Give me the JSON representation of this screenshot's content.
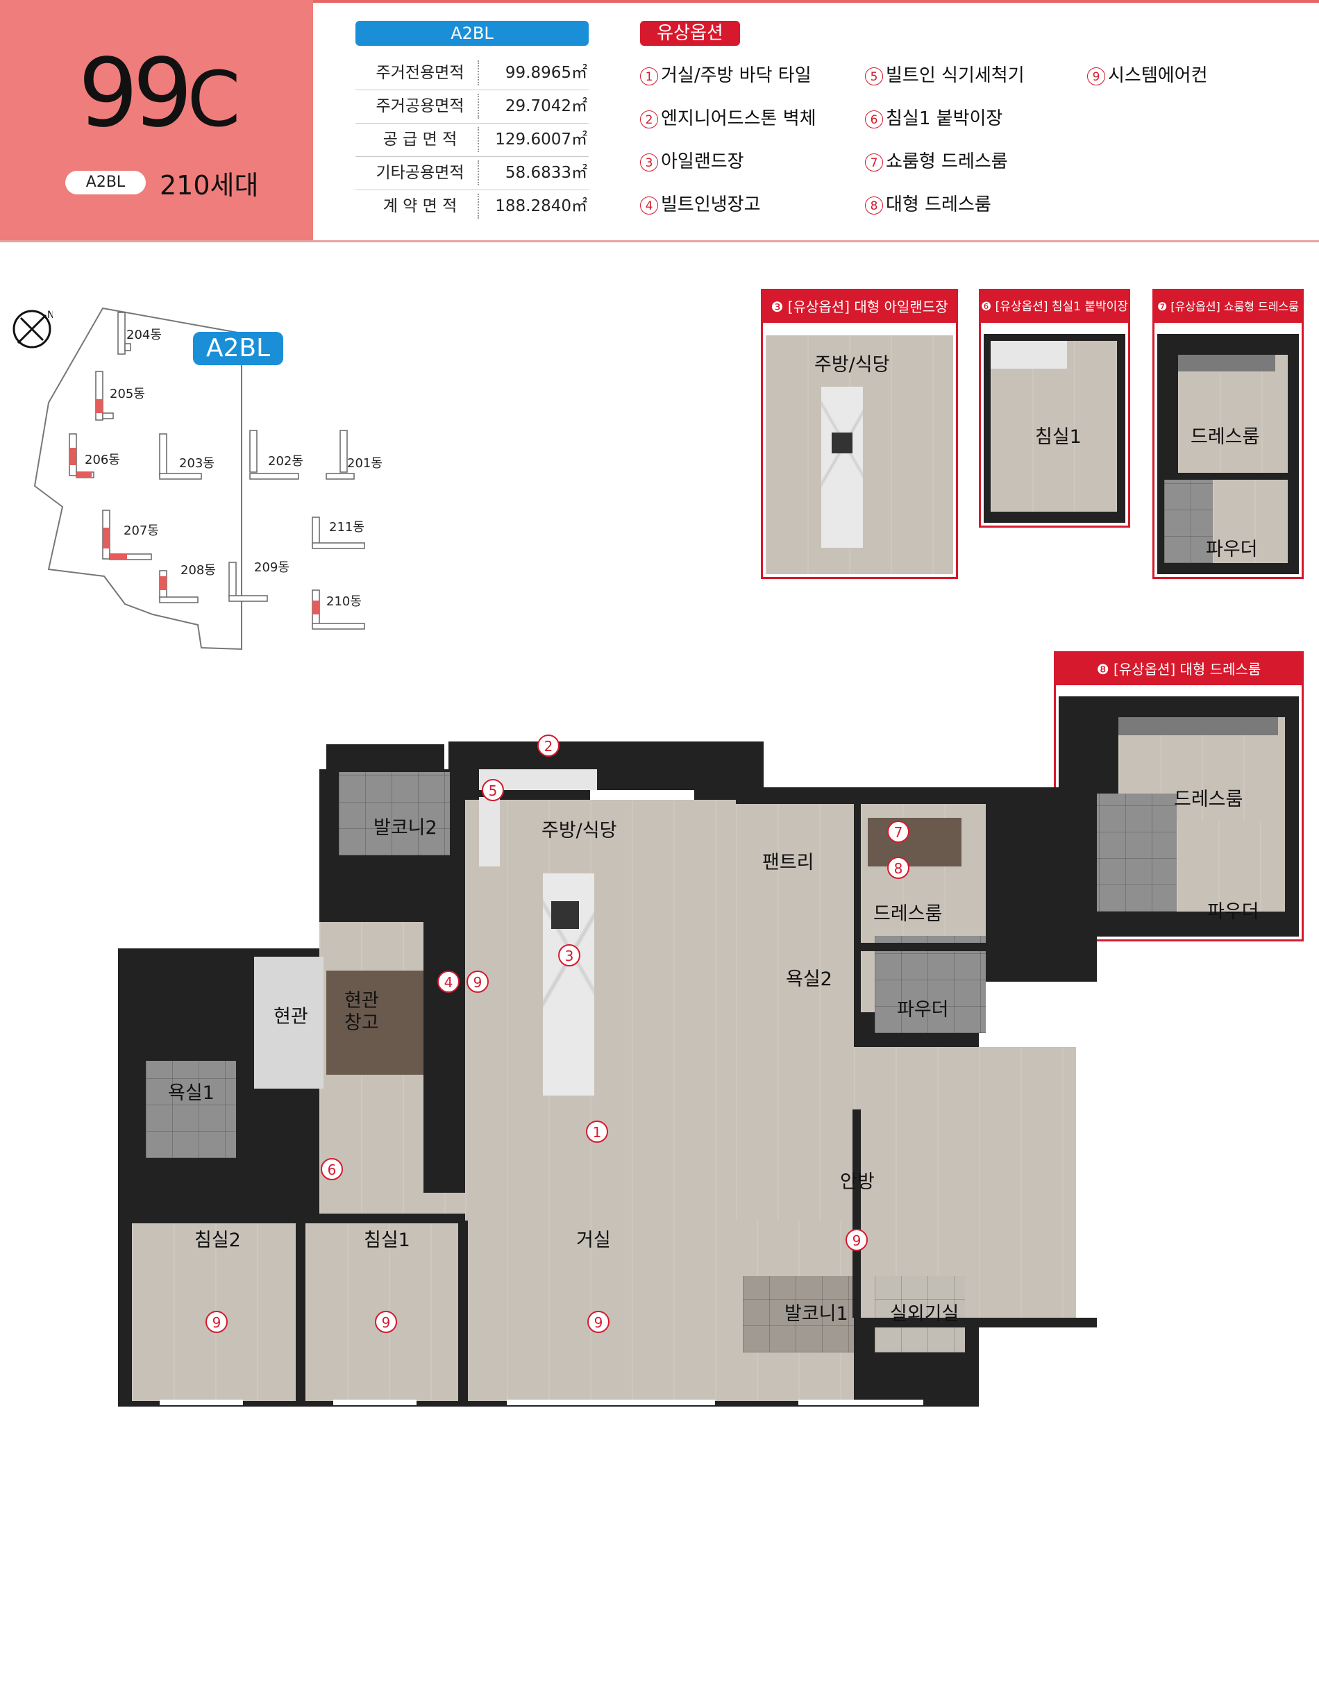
{
  "unit": {
    "type_number": "99",
    "type_suffix": "C",
    "block_tag": "A2BL",
    "households": "210세대"
  },
  "area_table": {
    "header": "A2BL",
    "rows": [
      {
        "label": "주거전용면적",
        "value": "99.8965㎡"
      },
      {
        "label": "주거공용면적",
        "value": "29.7042㎡"
      },
      {
        "label": "공 급 면 적",
        "value": "129.6007㎡"
      },
      {
        "label": "기타공용면적",
        "value": "58.6833㎡"
      },
      {
        "label": "계 약 면 적",
        "value": "188.2840㎡"
      }
    ]
  },
  "paid_options": {
    "header": "유상옵션",
    "items": [
      {
        "num": "1",
        "label": "거실/주방 바닥 타일"
      },
      {
        "num": "2",
        "label": "엔지니어드스톤 벽체"
      },
      {
        "num": "3",
        "label": "아일랜드장"
      },
      {
        "num": "4",
        "label": "빌트인냉장고"
      },
      {
        "num": "5",
        "label": "빌트인 식기세척기"
      },
      {
        "num": "6",
        "label": "침실1 붙박이장"
      },
      {
        "num": "7",
        "label": "쇼룸형 드레스룸"
      },
      {
        "num": "8",
        "label": "대형 드레스룸"
      },
      {
        "num": "9",
        "label": "시스템에어컨"
      }
    ]
  },
  "site_map": {
    "badge": "A2BL",
    "compass_letter": "N",
    "buildings": [
      "204동",
      "205동",
      "206동",
      "203동",
      "202동",
      "201동",
      "207동",
      "211동",
      "208동",
      "209동",
      "210동"
    ]
  },
  "option_panels": [
    {
      "title": "❸ [유상옵션] 대형 아일랜드장",
      "labels": [
        "주방/식당"
      ]
    },
    {
      "title": "❻ [유상옵션] 침실1 붙박이장",
      "labels": [
        "침실1"
      ]
    },
    {
      "title": "❼ [유상옵션] 쇼룸형 드레스룸",
      "labels": [
        "드레스룸",
        "파우더"
      ]
    },
    {
      "title": "❽ [유상옵션] 대형 드레스룸",
      "labels": [
        "드레스룸",
        "파우더"
      ]
    }
  ],
  "floor_plan": {
    "rooms": {
      "balcony2": "발코니2",
      "kitchen": "주방/식당",
      "pantry": "팬트리",
      "dressroom": "드레스룸",
      "entrance": "현관",
      "entrance_storage": "현관\n창고",
      "bath2": "욕실2",
      "powder": "파우더",
      "bath1": "욕실1",
      "master": "안방",
      "bed2": "침실2",
      "bed1": "침실1",
      "living": "거실",
      "balcony1": "발코니1",
      "ac_room": "실외기실"
    },
    "markers": {
      "m2": "2",
      "m5": "5",
      "m7": "7",
      "m8": "8",
      "m4": "4",
      "m9a": "9",
      "m3": "3",
      "m1": "1",
      "m6": "6",
      "m9b": "9",
      "m9c": "9",
      "m9d": "9",
      "m9e": "9"
    }
  },
  "colors": {
    "brand_pink": "#ef7d7b",
    "option_red": "#d7192d",
    "block_blue": "#1a8fd8"
  }
}
